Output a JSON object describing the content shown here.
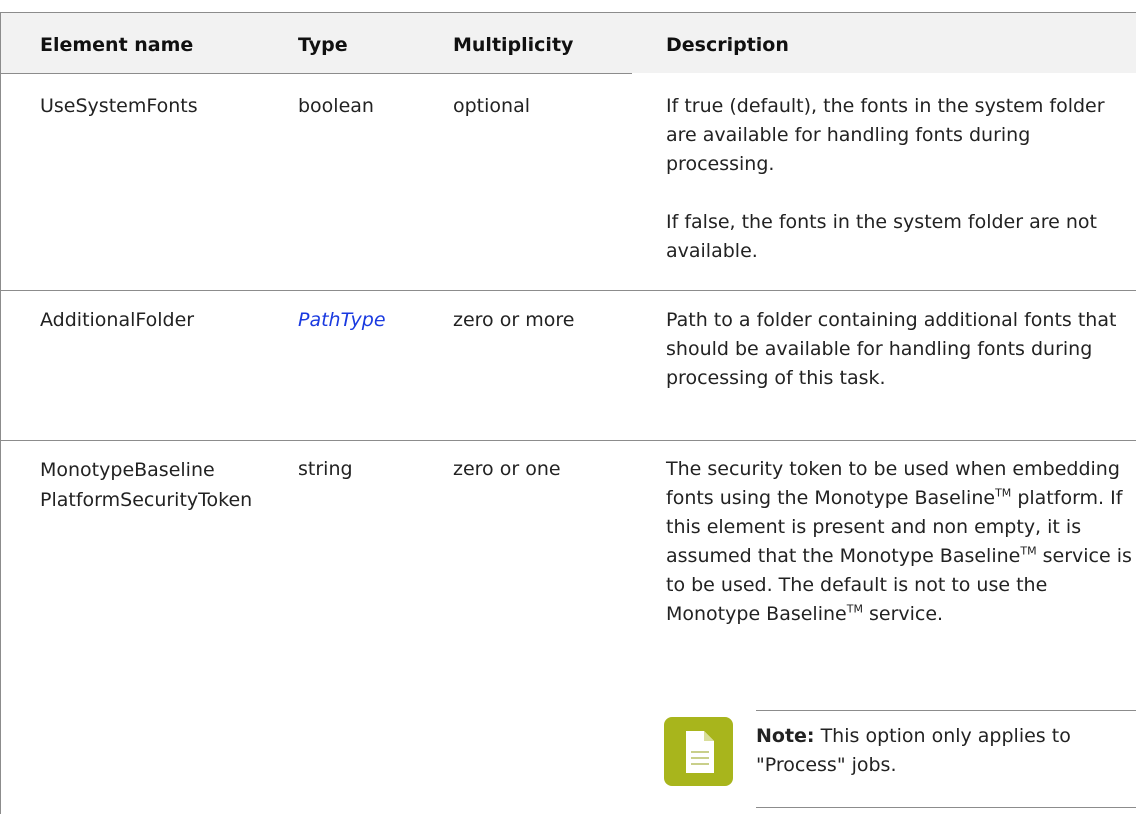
{
  "table": {
    "headers": {
      "element_name": "Element name",
      "type": "Type",
      "multiplicity": "Multiplicity",
      "description": "Description"
    },
    "rows": [
      {
        "name": "UseSystemFonts",
        "type": "boolean",
        "multiplicity": "optional",
        "description": [
          "If true (default), the fonts in the system folder are available for handling fonts during processing.",
          "If false, the fonts in the system folder are not available."
        ]
      },
      {
        "name": "AdditionalFolder",
        "type": "PathType",
        "multiplicity": "zero or more",
        "description": [
          "Path to a folder containing additional fonts that should be available for handling fonts during processing of this task."
        ]
      },
      {
        "name_line1": "MonotypeBaseline",
        "name_line2": "PlatformSecurityToken",
        "type": "string",
        "multiplicity": "zero or one",
        "description_parts": {
          "p1": "The security token to be used when embedding fonts using the Monotype Baseline",
          "tm": "TM",
          "p2": " platform. If this element is present and non empty, it is assumed that the Monotype Baseline",
          "p3": " service is to be used. The default is not to use the Monotype Baseline",
          "p4": " service."
        },
        "note": {
          "label": "Note:",
          "text": "This option only applies to \"Process\" jobs.",
          "icon": "note-document-icon"
        }
      }
    ]
  },
  "colors": {
    "link": "#1a3ae0",
    "header_bg": "#f2f2f2",
    "note_icon": "#a8b51c"
  }
}
